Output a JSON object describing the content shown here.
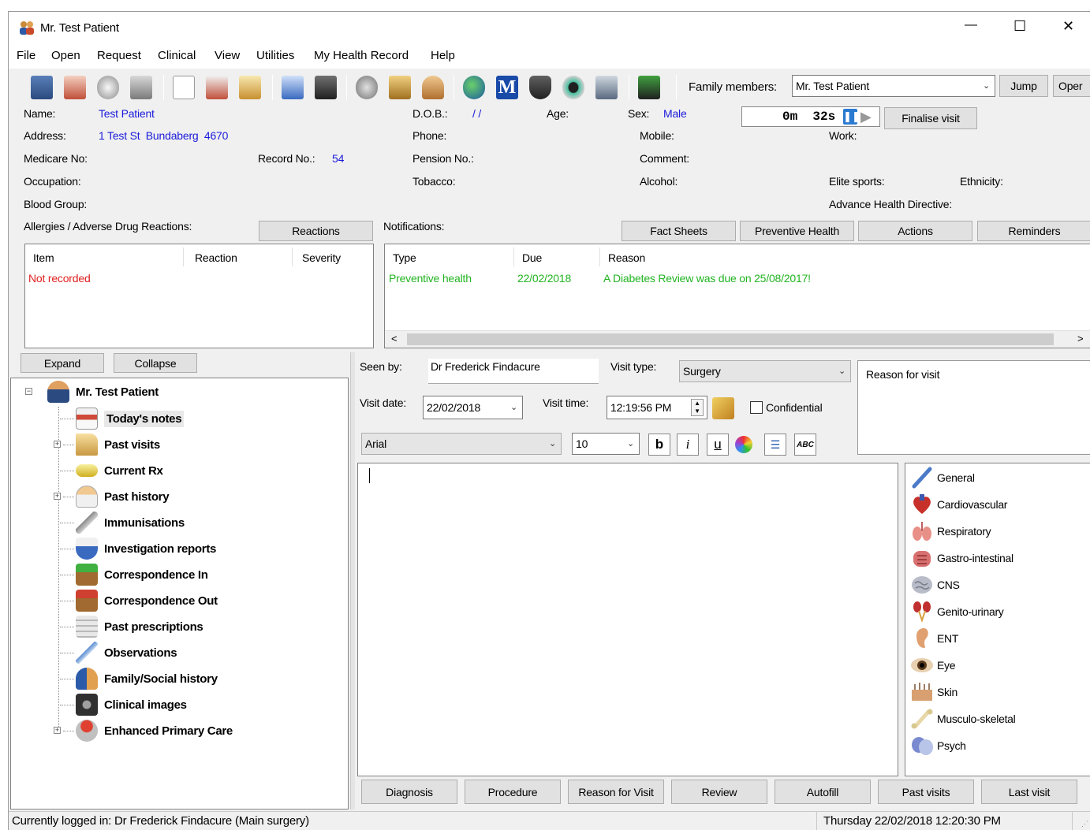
{
  "window": {
    "title": "Mr. Test Patient",
    "minimize": "—",
    "maximize": "☐",
    "close": "✕"
  },
  "menu": [
    "File",
    "Open",
    "Request",
    "Clinical",
    "View",
    "Utilities",
    "My Health Record",
    "Help"
  ],
  "toolbar": {
    "family_label": "Family members:",
    "family_value": "Mr. Test Patient",
    "jump_label": "Jump",
    "open_label": "Oper"
  },
  "demographics": {
    "name_label": "Name:",
    "name_value": "Test Patient",
    "dob_label": "D.O.B.:",
    "dob_value": "/ /",
    "age_label": "Age:",
    "sex_label": "Sex:",
    "sex_value": "Male",
    "address_label": "Address:",
    "address_value": "1 Test St  Bundaberg  4670",
    "phone_label": "Phone:",
    "mobile_label": "Mobile:",
    "work_label": "Work:",
    "medicare_label": "Medicare No:",
    "record_label": "Record No.:",
    "record_value": "54",
    "pension_label": "Pension No.:",
    "comment_label": "Comment:",
    "occupation_label": "Occupation:",
    "tobacco_label": "Tobacco:",
    "alcohol_label": "Alcohol:",
    "elite_label": "Elite sports:",
    "ethnicity_label": "Ethnicity:",
    "blood_label": "Blood Group:",
    "ahd_label": "Advance Health Directive:"
  },
  "timer": {
    "value": "0m  32s",
    "finalise_label": "Finalise visit"
  },
  "allergies": {
    "title": "Allergies / Adverse Drug Reactions:",
    "reactions_button": "Reactions",
    "columns": [
      "Item",
      "Reaction",
      "Severity"
    ],
    "empty_text": "Not recorded"
  },
  "notifications": {
    "title": "Notifications:",
    "buttons": [
      "Fact Sheets",
      "Preventive Health",
      "Actions",
      "Reminders"
    ],
    "columns": [
      "Type",
      "Due",
      "Reason"
    ],
    "rows": [
      {
        "type": "Preventive health",
        "due": "22/02/2018",
        "reason": "A Diabetes Review was due on 25/08/2017!"
      }
    ]
  },
  "tree": {
    "expand_label": "Expand",
    "collapse_label": "Collapse",
    "root": "Mr. Test Patient",
    "items": [
      "Today's notes",
      "Past visits",
      "Current Rx",
      "Past history",
      "Immunisations",
      "Investigation reports",
      "Correspondence In",
      "Correspondence Out",
      "Past prescriptions",
      "Observations",
      "Family/Social history",
      "Clinical images",
      "Enhanced Primary Care"
    ]
  },
  "visit": {
    "seen_by_label": "Seen by:",
    "seen_by_value": "Dr Frederick Findacure",
    "visit_type_label": "Visit type:",
    "visit_type_value": "Surgery",
    "reason_placeholder": "Reason for visit",
    "visit_date_label": "Visit date:",
    "visit_date_value": "22/02/2018",
    "visit_time_label": "Visit time:",
    "visit_time_value": "12:19:56 PM",
    "confidential_label": "Confidential",
    "font_value": "Arial",
    "size_value": "10",
    "bold_label": "b",
    "italic_label": "i",
    "underline_label": "u",
    "spell_label": "ABC"
  },
  "systems": [
    "General",
    "Cardiovascular",
    "Respiratory",
    "Gastro-intestinal",
    "CNS",
    "Genito-urinary",
    "ENT",
    "Eye",
    "Skin",
    "Musculo-skeletal",
    "Psych"
  ],
  "bottom_buttons": [
    "Diagnosis",
    "Procedure",
    "Reason for Visit",
    "Review",
    "Autofill",
    "Past visits",
    "Last visit"
  ],
  "status": {
    "logged_in": "Currently logged in:  Dr Frederick Findacure (Main surgery)",
    "datetime": "Thursday 22/02/2018 12:20:30 PM"
  },
  "colors": {
    "blue_value": "#1a1adb",
    "red_text": "#e02020",
    "green_text": "#22b422",
    "window_bg": "#f0f0f0"
  }
}
